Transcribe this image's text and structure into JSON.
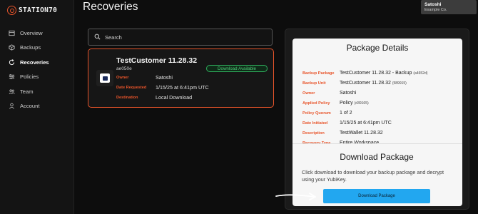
{
  "brand": {
    "name": "STATION70",
    "accent": "#e8542a"
  },
  "page": {
    "title": "Recoveries"
  },
  "user": {
    "name": "Satoshi",
    "org": "Example Co."
  },
  "sidebar": {
    "items": [
      {
        "label": "Overview",
        "icon": "grid-icon",
        "active": false
      },
      {
        "label": "Backups",
        "icon": "package-icon",
        "active": false
      },
      {
        "label": "Recoveries",
        "icon": "refresh-icon",
        "active": true
      },
      {
        "label": "Policies",
        "icon": "sliders-icon",
        "active": false
      },
      {
        "label": "Team",
        "icon": "users-icon",
        "active": false
      },
      {
        "label": "Account",
        "icon": "person-icon",
        "active": false
      }
    ]
  },
  "search": {
    "placeholder": "Search"
  },
  "recovery_card": {
    "title": "TestCustomer 11.28.32",
    "subtitle": "ae050e",
    "badge": "Download Available",
    "fields": [
      {
        "label": "Owner",
        "value": "Satoshi"
      },
      {
        "label": "Date Requested",
        "value": "1/15/25 at 6:41pm UTC"
      },
      {
        "label": "Destination",
        "value": "Local Download"
      }
    ]
  },
  "details": {
    "title": "Package Details",
    "rows": [
      {
        "label": "Backup Package",
        "value": "TestCustomer 11.28.32 - Backup",
        "suffix": "(a4652d)"
      },
      {
        "label": "Backup Unit",
        "value": "TestCustomer 11.28.32",
        "suffix": "(589915)"
      },
      {
        "label": "Owner",
        "value": "Satoshi",
        "suffix": ""
      },
      {
        "label": "Applied Policy",
        "value": "Policy",
        "suffix": "(d39165)"
      },
      {
        "label": "Policy Quorum",
        "value": "1 of 2",
        "suffix": ""
      },
      {
        "label": "Date Initiated",
        "value": "1/15/25 at 6:41pm UTC",
        "suffix": ""
      },
      {
        "label": "Description",
        "value": "TestWallet 11.28.32",
        "suffix": ""
      },
      {
        "label": "Recovery Type",
        "value": "Entire Workspace",
        "suffix": ""
      }
    ]
  },
  "download": {
    "title": "Download Package",
    "text": "Click download to download your backup package and decrypt using your YubiKey.",
    "button_label": "Download Package"
  }
}
